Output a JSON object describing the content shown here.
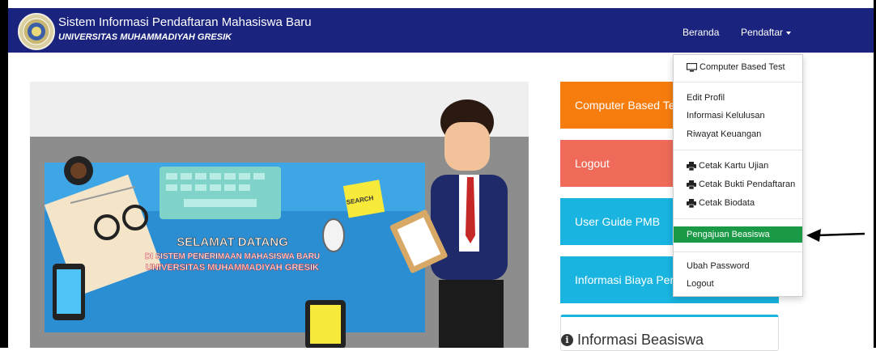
{
  "navbar": {
    "title": "Sistem Informasi Pendaftaran Mahasiswa Baru",
    "subtitle": "UNIVERSITAS MUHAMMADIYAH GRESIK",
    "links": {
      "beranda": "Beranda",
      "pendaftar": "Pendaftar"
    }
  },
  "hero": {
    "welcome": "SELAMAT DATANG",
    "line2": "DI SISTEM PENERIMAAN MAHASISWA BARU",
    "line3": "UNIVERSITAS MUHAMMADIYAH GRESIK",
    "search_note": "SEARCH"
  },
  "sidebar": {
    "buttons": [
      "Computer Based Test",
      "Logout",
      "User Guide PMB",
      "Informasi Biaya Pendidikan"
    ],
    "info_title": "Informasi Beasiswa",
    "info_icon": "info-circle-icon"
  },
  "dropdown": {
    "items": [
      {
        "label": "Computer Based Test",
        "icon": "monitor-icon"
      },
      {
        "label": "Edit Profil"
      },
      {
        "label": "Informasi Kelulusan"
      },
      {
        "label": "Riwayat Keuangan"
      },
      {
        "label": "Cetak Kartu Ujian",
        "icon": "print-icon"
      },
      {
        "label": "Cetak Bukti Pendaftaran",
        "icon": "print-icon"
      },
      {
        "label": "Cetak Biodata",
        "icon": "print-icon"
      },
      {
        "label": "Pengajuan Beasiswa",
        "active": true
      },
      {
        "label": "Ubah Password"
      },
      {
        "label": "Logout"
      }
    ]
  },
  "colors": {
    "navbar": "#1a237e",
    "orange": "#f57c0d",
    "red": "#ef6a58",
    "cyan": "#19b4e0",
    "active_green": "#1a9a46"
  }
}
